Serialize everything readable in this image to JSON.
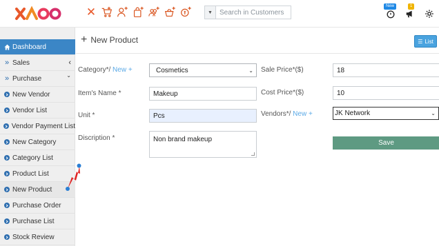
{
  "app": {
    "logo_text": "XAOO"
  },
  "toolbar": {
    "icons": [
      "close-icon",
      "cart-add-icon",
      "user-add-icon",
      "bag-add-icon",
      "users-add-icon",
      "basket-add-icon",
      "coin-add-icon"
    ],
    "search_placeholder": "Search in Customers"
  },
  "header_right": {
    "clock_badge": "New",
    "megaphone_badge": "1"
  },
  "sidebar": {
    "items": [
      {
        "label": "Dashboard",
        "icon": "home-icon",
        "active": true
      },
      {
        "label": "Sales",
        "icon": "double-chevron-icon",
        "caret": "‹"
      },
      {
        "label": "Purchase",
        "icon": "double-chevron-icon",
        "caret": "⌄"
      },
      {
        "label": "New Vendor",
        "icon": "circle-chevron-icon"
      },
      {
        "label": "Vendor List",
        "icon": "circle-chevron-icon"
      },
      {
        "label": "Vendor Payment List",
        "icon": "circle-chevron-icon"
      },
      {
        "label": "New Category",
        "icon": "circle-chevron-icon"
      },
      {
        "label": "Category List",
        "icon": "circle-chevron-icon"
      },
      {
        "label": "Product List",
        "icon": "circle-chevron-icon"
      },
      {
        "label": "New Product",
        "icon": "circle-chevron-icon",
        "highlighted": true
      },
      {
        "label": "Purchase Order",
        "icon": "circle-chevron-icon"
      },
      {
        "label": "Purchase List",
        "icon": "circle-chevron-icon"
      },
      {
        "label": "Stock Review",
        "icon": "circle-chevron-icon"
      }
    ]
  },
  "page": {
    "title": "New Product",
    "list_button": "List"
  },
  "form": {
    "category_label": "Category*/",
    "category_new": "New +",
    "category_value": "Cosmetics",
    "item_name_label": "Item's Name *",
    "item_name_value": "Makeup",
    "unit_label": "Unit *",
    "unit_value": "Pcs",
    "description_label": "Discription *",
    "description_value": "Non brand makeup",
    "sale_price_label": "Sale Price*($)",
    "sale_price_value": "18",
    "cost_price_label": "Cost Price*($)",
    "cost_price_value": "10",
    "vendors_label": "Vendors*/",
    "vendors_new": "New +",
    "vendors_value": "JK Network",
    "save_button": "Save"
  },
  "colors": {
    "accent_orange": "#d9541e",
    "sidebar_active": "#3b86c6",
    "save_button": "#5e9a82",
    "list_button": "#4aa3df"
  }
}
